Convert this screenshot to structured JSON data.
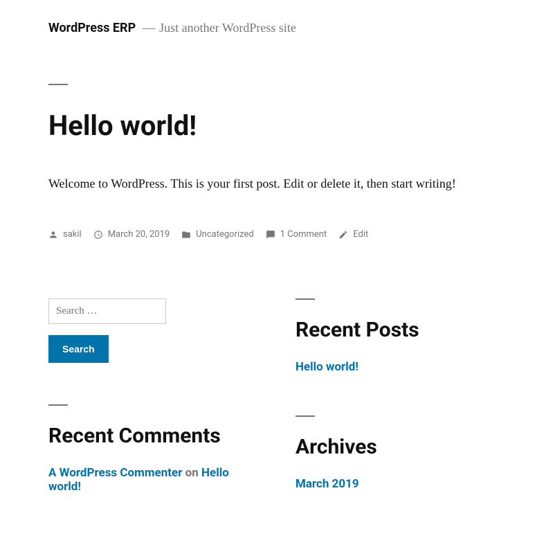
{
  "header": {
    "site_title": "WordPress ERP",
    "separator": "—",
    "tagline": "Just another WordPress site"
  },
  "post": {
    "title": "Hello world!",
    "content": "Welcome to WordPress. This is your first post. Edit or delete it, then start writing!",
    "meta": {
      "author": "sakil",
      "date": "March 20, 2019",
      "category": "Uncategorized",
      "comments": "1 Comment",
      "edit": "Edit"
    }
  },
  "search": {
    "placeholder": "Search …",
    "button": "Search"
  },
  "widgets": {
    "recent_posts": {
      "title": "Recent Posts",
      "items": {
        "0": {
          "label": "Hello world!"
        }
      }
    },
    "recent_comments": {
      "title": "Recent Comments",
      "items": {
        "0": {
          "author": "A WordPress Commenter",
          "on": "on",
          "post": "Hello world!"
        }
      }
    },
    "archives": {
      "title": "Archives",
      "items": {
        "0": {
          "label": "March 2019"
        }
      }
    }
  }
}
